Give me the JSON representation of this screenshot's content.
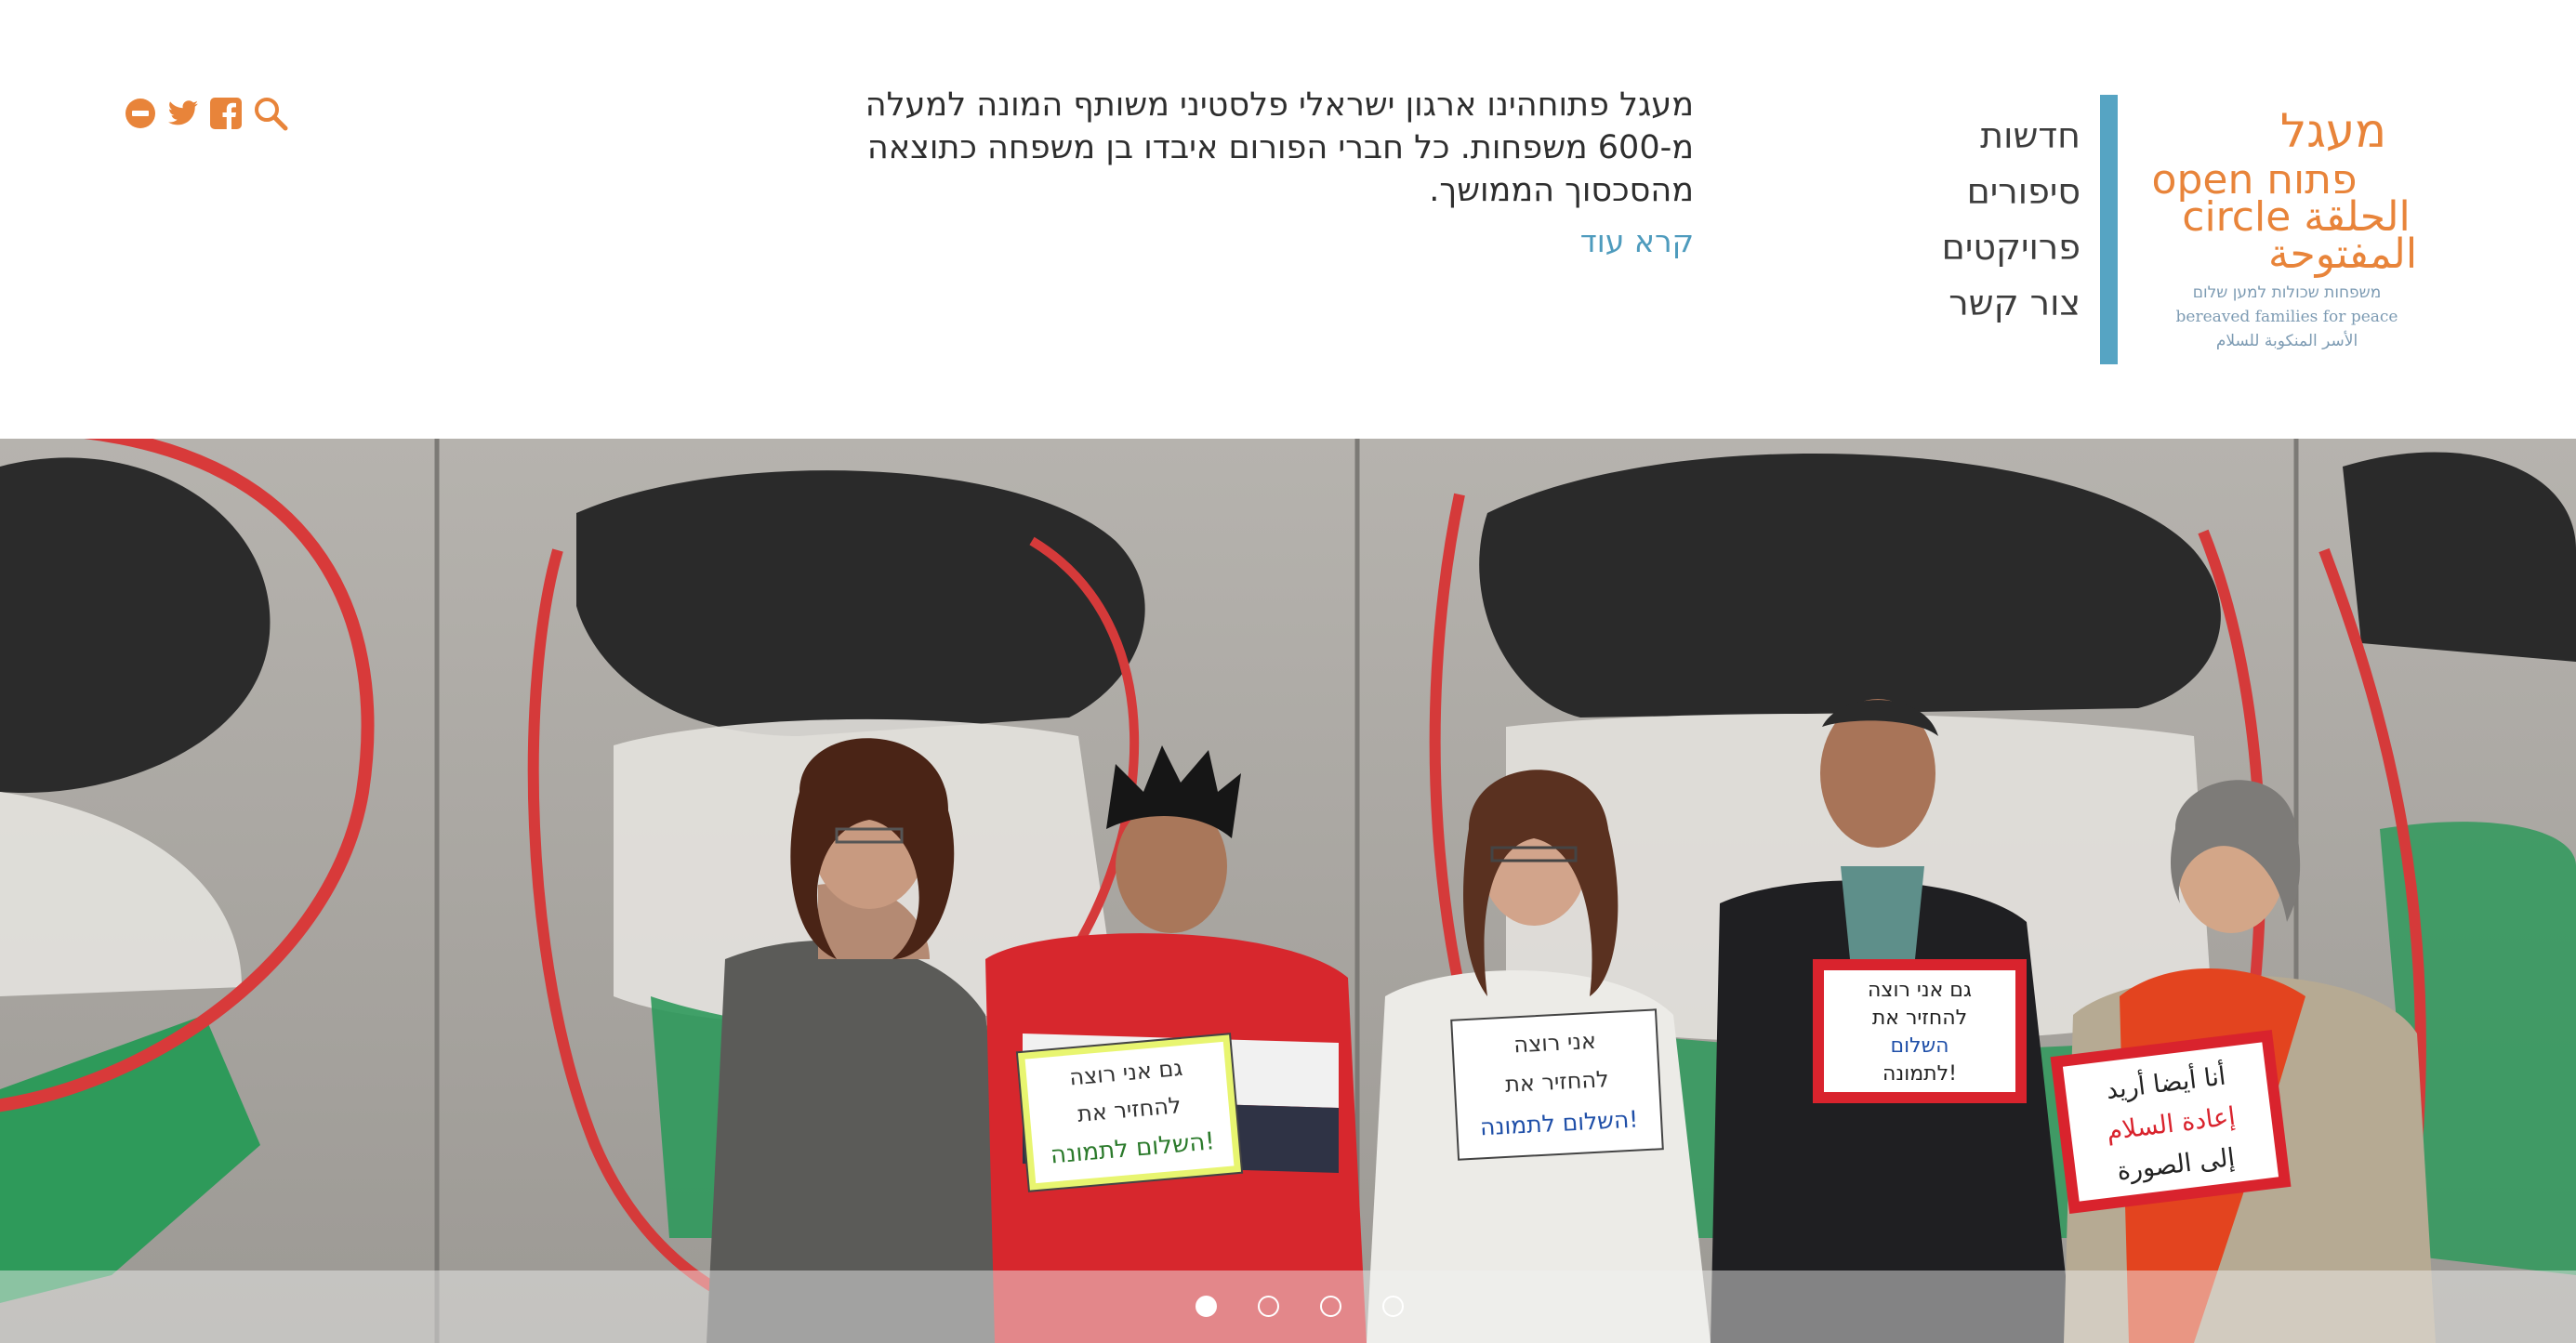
{
  "logo": {
    "lines": [
      "מעגל",
      "open פתוח",
      "circle الحلقة",
      "المفتوحة"
    ],
    "tagline_he": "משפחות שכולות למען שלום",
    "tagline_en": "bereaved families for peace",
    "tagline_ar": "الأسر المنكوبة للسلام",
    "color": "#e8843a",
    "tagline_color": "#7d9bb3"
  },
  "nav": {
    "items": [
      "חדשות",
      "סיפורים",
      "פרויקטים",
      "צור קשר"
    ],
    "accent": "#56a4c3"
  },
  "about": {
    "text": "מעגל פתוחהינו ארגון ישראלי פלסטיני משותף המונה למעלה מ-600 משפחות. כל חברי הפורום איבדו בן משפחה כתוצאה מהסכסוך הממושך.",
    "read_more": "קרא עוד"
  },
  "social": {
    "icons": [
      "minus-circle-icon",
      "twitter-icon",
      "facebook-icon",
      "search-icon"
    ],
    "color": "#e8843a"
  },
  "hero": {
    "signs": [
      {
        "lines": [
          "גם אני רוצה",
          "להחזיר את",
          "השלום לתמונה!"
        ]
      },
      {
        "lines": [
          "אני רוצה",
          "להחזיר את",
          "השלום לתמונה!"
        ]
      },
      {
        "lines": [
          "גם אני רוצה",
          "להחזיר את",
          "השלום",
          "לתמונה!"
        ]
      },
      {
        "lines": [
          "أنا أيضا أريد",
          "إعادة السلام",
          "إلى الصورة"
        ]
      }
    ],
    "slides": {
      "count": 4,
      "active_index": 0
    }
  }
}
